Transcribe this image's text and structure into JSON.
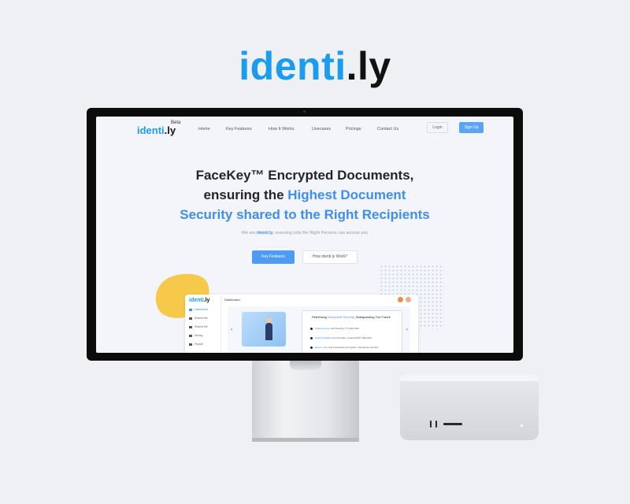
{
  "brand": {
    "part1": "identi",
    "part2": ".ly"
  },
  "site": {
    "logo": {
      "part1": "identi",
      "part2": ".ly",
      "badge": "Beta"
    },
    "nav": [
      "Home",
      "Key Features",
      "How It Works",
      "Usecases",
      "Pricings",
      "Contact Us"
    ],
    "login_label": "Login",
    "signup_label": "Sign Up",
    "hero": {
      "line1": "FaceKey™ Encrypted Documents,",
      "line2_plain": "ensuring the ",
      "line2_blue": "Highest Document",
      "line3_blue": "Security shared to the Right Recipients"
    },
    "subtitle": {
      "before": "We are ",
      "brand": "identi.ly",
      "after": ", ensuring only the Right Persons can access you"
    },
    "cta_primary": "Key Features",
    "cta_secondary": "How identi.ly Work?"
  },
  "dashboard": {
    "logo": {
      "part1": "identi",
      "part2": ".ly"
    },
    "title": "Dashboard",
    "sidebar": [
      {
        "label": "Dashboard",
        "active": true
      },
      {
        "label": "Shared file",
        "active": false
      },
      {
        "label": "Shared file",
        "active": false
      },
      {
        "label": "Money",
        "active": false
      },
      {
        "label": "Payroll",
        "active": false
      }
    ],
    "panel": {
      "title_plain1": "Rethinking ",
      "title_blue": "Document Security",
      "title_plain2": ", Safeguarding Our Future",
      "points": [
        {
          "blue": "Highly Secure",
          "plain": " with FaceKey™ UUID DNA"
        },
        {
          "blue": "Highly Scalable",
          "plain": " and Accurate, meeting NIST Standard"
        },
        {
          "blue": "Easy to Use",
          "plain": " and Convenient encryption / decryption process"
        }
      ]
    },
    "prev_arrow": "‹",
    "next_arrow": "›"
  },
  "colors": {
    "accent": "#1a9cf0",
    "blue_text": "#3d8ef2",
    "button": "#4e9bf4",
    "blob": "#f7c94a"
  }
}
